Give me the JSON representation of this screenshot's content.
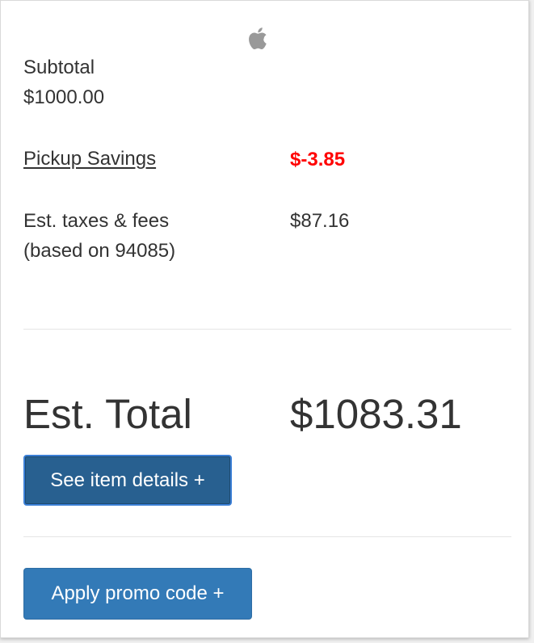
{
  "logo": {
    "icon": "apple-icon",
    "color": "#999999"
  },
  "subtotal": {
    "label": "Subtotal",
    "value": "$1000.00"
  },
  "pickup_savings": {
    "label": "Pickup Savings",
    "value": "$-3.85",
    "color": "#ff0000"
  },
  "taxes": {
    "label_line1": "Est. taxes & fees",
    "label_line2": "(based on 94085)",
    "value": "$87.16"
  },
  "total": {
    "label": "Est. Total",
    "value": "$1083.31"
  },
  "buttons": {
    "see_item_details": "See item details +",
    "apply_promo_code": "Apply promo code +"
  },
  "colors": {
    "primary_button": "#337ab7",
    "active_button": "#286090",
    "text": "#333333"
  }
}
